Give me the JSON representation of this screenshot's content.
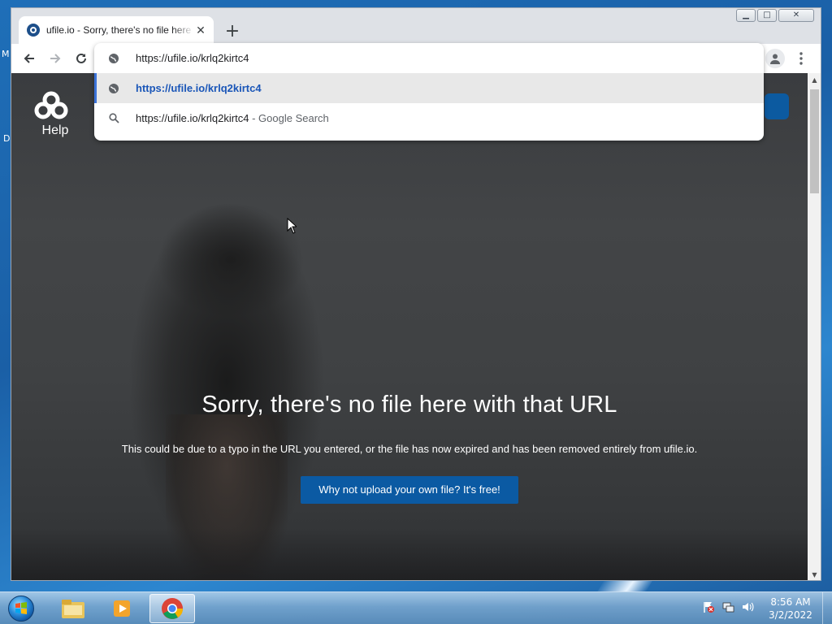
{
  "desktop": {
    "edge_letters": [
      "M",
      "D"
    ]
  },
  "browser": {
    "tab": {
      "title": "ufile.io - Sorry, there's no file here with that URL",
      "close_glyph": "✕"
    },
    "new_tab_glyph": "+",
    "window_controls": {
      "minimize": "▁",
      "maximize": "□",
      "close": "✕"
    },
    "omnibox": {
      "value": "https://ufile.io/krlq2kirtc4",
      "suggestions": [
        {
          "icon": "globe-icon",
          "url": "https://ufile.io/krlq2kirtc4",
          "suffix": "",
          "selected": true
        },
        {
          "icon": "search-icon",
          "url": "https://ufile.io/krlq2kirtc4",
          "suffix": "Google Search",
          "separator": "-",
          "selected": false
        }
      ]
    }
  },
  "page": {
    "logo_label": "Help",
    "title": "Sorry, there's no file here with that URL",
    "message": "This could be due to a typo in the URL you entered, or the file has now expired and has been removed entirely from ufile.io.",
    "cta_label": "Why not upload your own file? It's free!"
  },
  "taskbar": {
    "clock": {
      "time": "8:56 AM",
      "date": "3/2/2022"
    }
  },
  "colors": {
    "accent": "#0b5aa3",
    "suggestion_link": "#1a56b8",
    "selected_row_bar": "#3b73d9"
  }
}
